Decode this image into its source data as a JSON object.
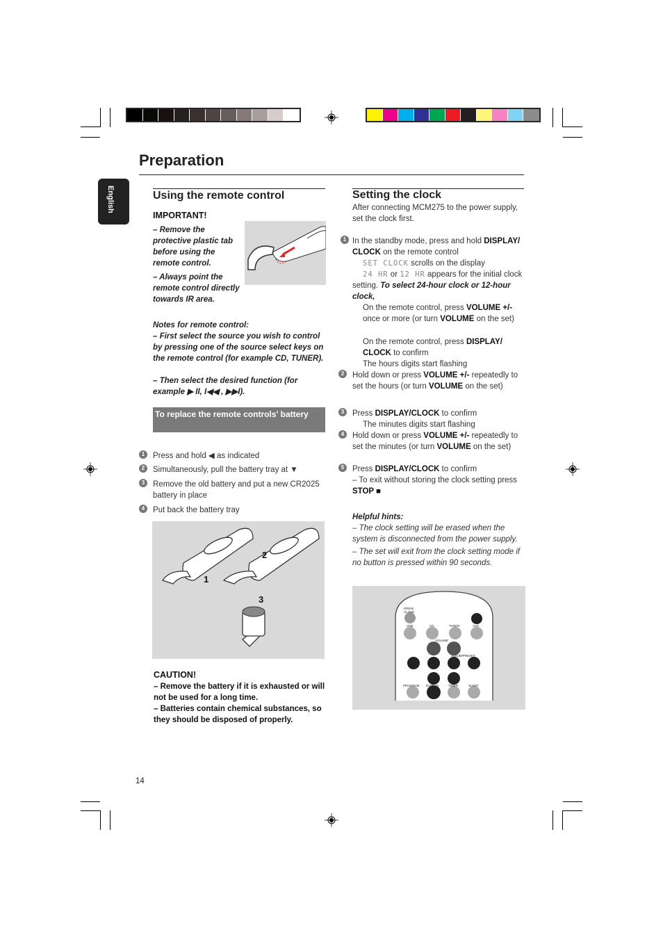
{
  "colors": {
    "gray_bar": [
      "#000000",
      "#0a0807",
      "#171211",
      "#262120",
      "#3a302d",
      "#4e4542",
      "#675d5a",
      "#857a77",
      "#a89e9c",
      "#d5cccb",
      "#ffffff"
    ],
    "color_bar": [
      "#fff200",
      "#ec008c",
      "#00aeef",
      "#2e3192",
      "#00a651",
      "#ed1c24",
      "#231f20",
      "#fff57a",
      "#f583c3",
      "#7fd4f5",
      "#8c8c8c"
    ]
  },
  "page": {
    "title": "Preparation",
    "language_tab": "English",
    "page_number": "14"
  },
  "remote": {
    "heading": "Using the remote control",
    "important": "IMPORTANT!",
    "imp1": "–  Remove the protective plastic tab before using the remote control.",
    "imp2": "–  Always point the remote control directly towards IR area.",
    "notes_title": "Notes for remote control:",
    "note1": "–  First select the source you wish to control by pressing one of the source select keys on the remote control (for example CD, TUNER).",
    "note2": "–  Then select the desired function (for example  ▶ II,  I◀◀ ,  ▶▶I).",
    "banner": "To replace the remote controls' battery",
    "steps": [
      "Press and hold ◀  as indicated",
      "Simultaneously, pull the battery tray at  ▼",
      "Remove the old battery and put a new CR2025 battery in place",
      "Put back the battery tray"
    ],
    "figure_labels": [
      "1",
      "2",
      "3"
    ],
    "caution_title": "CAUTION!",
    "caution1": "–  Remove the battery if it is exhausted or will not be used for a long time.",
    "caution2": "–  Batteries contain chemical substances, so they should be disposed of properly."
  },
  "clock": {
    "heading": "Setting the clock",
    "intro": "After connecting MCM275 to the power supply, set the clock first.",
    "s1a": "In the standby mode, press and hold ",
    "s1b": "DISPLAY/ CLOCK",
    "s1c": " on the remote control",
    "lcd1": "SET CLOCK",
    "lcd1t": " scrolls on the display",
    "lcd2": "24 HR",
    "or": " or ",
    "lcd3": "12 HR",
    "lcd3t": " appears for the initial clock setting. ",
    "select": "To select 24-hour clock or 12-hour clock,",
    "sub1a": "On the remote control, press ",
    "vol": "VOLUME +/-",
    "sub1b": " once or more (or turn ",
    "volume": "VOLUME",
    "sub1c": " on the set)",
    "sub2a": "On the remote control, press ",
    "dc": "DISPLAY/ CLOCK",
    "sub2b": " to confirm",
    "hours_flash": "The hours digits start flashing",
    "s2a": "Hold down or press ",
    "s2b": " repeatedly to set the hours (or turn ",
    "s2c": " on the set)",
    "s3a": "Press ",
    "dc2": "DISPLAY/CLOCK",
    "s3b": " to confirm",
    "min_flash": "The minutes digits start flashing",
    "s4b": " repeatedly to set the minutes (or turn ",
    "s5c": "– To exit without storing the clock setting press ",
    "stop": "STOP ■",
    "hints_title": "Helpful hints:",
    "hint1": "–  The clock setting will be erased when the system is disconnected from the power supply.",
    "hint2": "–  The set will exit from the clock setting mode if no button is pressed within 90 seconds.",
    "remote_labels": {
      "open_close": "OPEN/ CLOSE",
      "usb": "USB",
      "cd": "CD",
      "tuner": "TUNER",
      "aux": "AUX",
      "volume": "VOLUME",
      "album": "ALBUM/PRESET",
      "program": "PROGRAM",
      "display": "DISPLAY",
      "timer": "TIMER",
      "sleep": "SLEEP"
    }
  }
}
